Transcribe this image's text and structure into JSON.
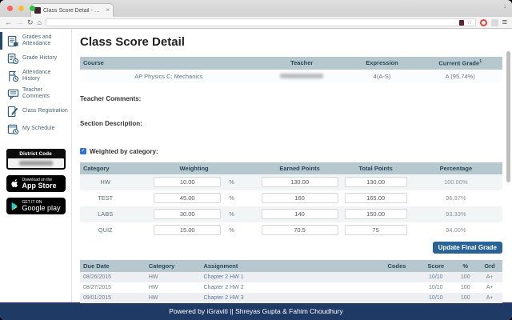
{
  "browser": {
    "tab_title": "Class Score Detail - Powe",
    "tab_close": "×",
    "back": "←",
    "forward": "→",
    "refresh": "↻",
    "home": "⌂",
    "star": "☆",
    "menu": "≡",
    "profile": "↓",
    "url": ""
  },
  "sidebar": {
    "items": [
      {
        "label": "Grades and Attendance"
      },
      {
        "label": "Grade History"
      },
      {
        "label": "Attendance History"
      },
      {
        "label": "Teacher Comments"
      },
      {
        "label": "Class Registration"
      },
      {
        "label": "My Schedule"
      }
    ],
    "district_code_label": "District Code",
    "app_store": {
      "line1": "Download on the",
      "line2": "App Store"
    },
    "google_play": {
      "line1": "GET IT ON",
      "line2": "Google play"
    }
  },
  "main": {
    "title": "Class Score Detail",
    "course_table": {
      "headers": [
        "Course",
        "Teacher",
        "Expression",
        "Current Grade"
      ],
      "current_grade_sup": "1",
      "row": {
        "course": "AP Physics C: Mechanics",
        "expression": "4(A-S)",
        "current_grade": "A  (95.74%)"
      }
    },
    "teacher_comments_label": "Teacher Comments:",
    "section_description_label": "Section Description:",
    "weighted_label": "Weighted by category:",
    "weighting_table": {
      "headers": [
        "Category",
        "Weighting",
        "Earned Points",
        "Total Points",
        "Percentage"
      ],
      "percent_sign": "%",
      "rows": [
        {
          "category": "HW",
          "weighting": "10.00",
          "earned": "130.00",
          "total": "130.00",
          "percentage": "100.00%"
        },
        {
          "category": "TEST",
          "weighting": "45.00",
          "earned": "160",
          "total": "165.00",
          "percentage": "96.97%"
        },
        {
          "category": "LABS",
          "weighting": "30.00",
          "earned": "140",
          "total": "150.00",
          "percentage": "93.33%"
        },
        {
          "category": "QUIZ",
          "weighting": "15.00",
          "earned": "70.5",
          "total": "75",
          "percentage": "94.00%"
        }
      ]
    },
    "update_button": "Update Final Grade",
    "assignments_table": {
      "headers": [
        "Due Date",
        "Category",
        "Assignment",
        "Codes",
        "Score",
        "%",
        "Grd"
      ],
      "rows": [
        {
          "due_date": "08/26/2015",
          "category": "HW",
          "assignment": "Chapter 2 HW 1",
          "codes": "",
          "score": "10/10",
          "percent": "100",
          "grd": "A+"
        },
        {
          "due_date": "08/27/2015",
          "category": "HW",
          "assignment": "Chapter 2 HW 2",
          "codes": "",
          "score": "10/10",
          "percent": "100",
          "grd": "A+"
        },
        {
          "due_date": "09/01/2015",
          "category": "HW",
          "assignment": "Chapter 2 HW 3",
          "codes": "",
          "score": "10/10",
          "percent": "100",
          "grd": "A+"
        }
      ]
    }
  },
  "footer": {
    "text": "Powered by iGraviti || Shreyas Gupta & Fahim Choudhury"
  },
  "colors": {
    "table_header": "#b6c8cd",
    "header_text": "#27485a",
    "footer_navy": "#203a66",
    "button_blue": "#2a6496",
    "active_item_blue": "#1b4b74",
    "checkbox_blue": "#2f71d8"
  }
}
